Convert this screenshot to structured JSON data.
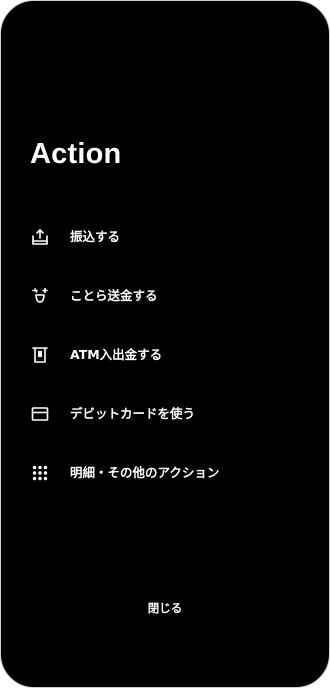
{
  "sheet": {
    "title": "Action",
    "items": [
      {
        "label": "振込する",
        "icon": "transfer-icon"
      },
      {
        "label": "ことら送金する",
        "icon": "cotra-send-icon"
      },
      {
        "label": "ATM入出金する",
        "icon": "atm-icon"
      },
      {
        "label": "デビットカードを使う",
        "icon": "card-icon"
      },
      {
        "label": "明細・その他のアクション",
        "icon": "grid-icon"
      }
    ],
    "close_label": "閉じる"
  },
  "colors": {
    "background": "#000000",
    "text": "#ffffff"
  }
}
